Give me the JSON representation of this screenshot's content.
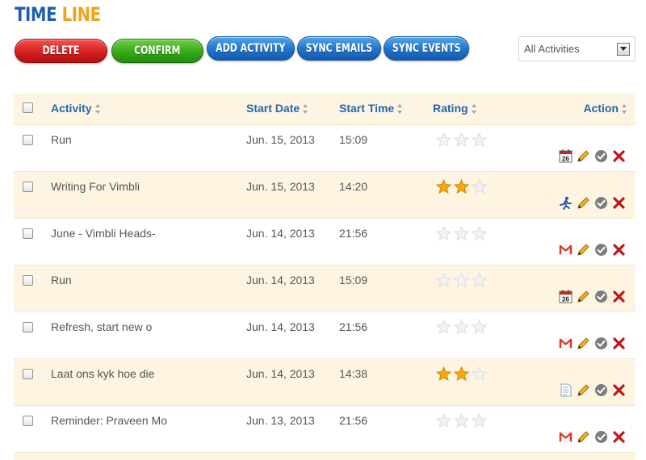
{
  "header": {
    "title_part1": "TIME",
    "title_part2": "LINE"
  },
  "toolbar": {
    "delete_label": "DELETE",
    "confirm_label": "CONFIRM",
    "add_activity_label": "ADD ACTIVITY",
    "sync_emails_label": "SYNC EMAILS",
    "sync_events_label": "SYNC EVENTS",
    "filter_value": "All Activities"
  },
  "table": {
    "columns": {
      "activity": "Activity",
      "start_date": "Start Date",
      "start_time": "Start Time",
      "rating": "Rating",
      "action": "Action"
    },
    "rows": [
      {
        "activity": "Run",
        "date": "Jun. 15, 2013",
        "time": "15:09",
        "rating": 0,
        "source_icon": "calendar-icon"
      },
      {
        "activity": "Writing For Vimbli",
        "date": "Jun. 15, 2013",
        "time": "14:20",
        "rating": 2,
        "source_icon": "running-man-icon"
      },
      {
        "activity": "June - Vimbli Heads-",
        "date": "Jun. 14, 2013",
        "time": "21:56",
        "rating": 0,
        "source_icon": "gmail-icon"
      },
      {
        "activity": "Run",
        "date": "Jun. 14, 2013",
        "time": "15:09",
        "rating": 0,
        "source_icon": "calendar-icon"
      },
      {
        "activity": "Refresh, start new o",
        "date": "Jun. 14, 2013",
        "time": "21:56",
        "rating": 0,
        "source_icon": "gmail-icon"
      },
      {
        "activity": "Laat ons kyk hoe die",
        "date": "Jun. 14, 2013",
        "time": "14:38",
        "rating": 2,
        "source_icon": "note-icon"
      },
      {
        "activity": "Reminder: Praveen Mo",
        "date": "Jun. 13, 2013",
        "time": "21:56",
        "rating": 0,
        "source_icon": "gmail-icon"
      }
    ]
  },
  "calendar_day": "26",
  "colors": {
    "title_blue": "#1d5fa8",
    "title_orange": "#f1a318",
    "header_link": "#2366ad",
    "row_alt_bg": "#fdf5e2",
    "star_on": "#f5a810",
    "star_off": "#dcdcdc"
  }
}
